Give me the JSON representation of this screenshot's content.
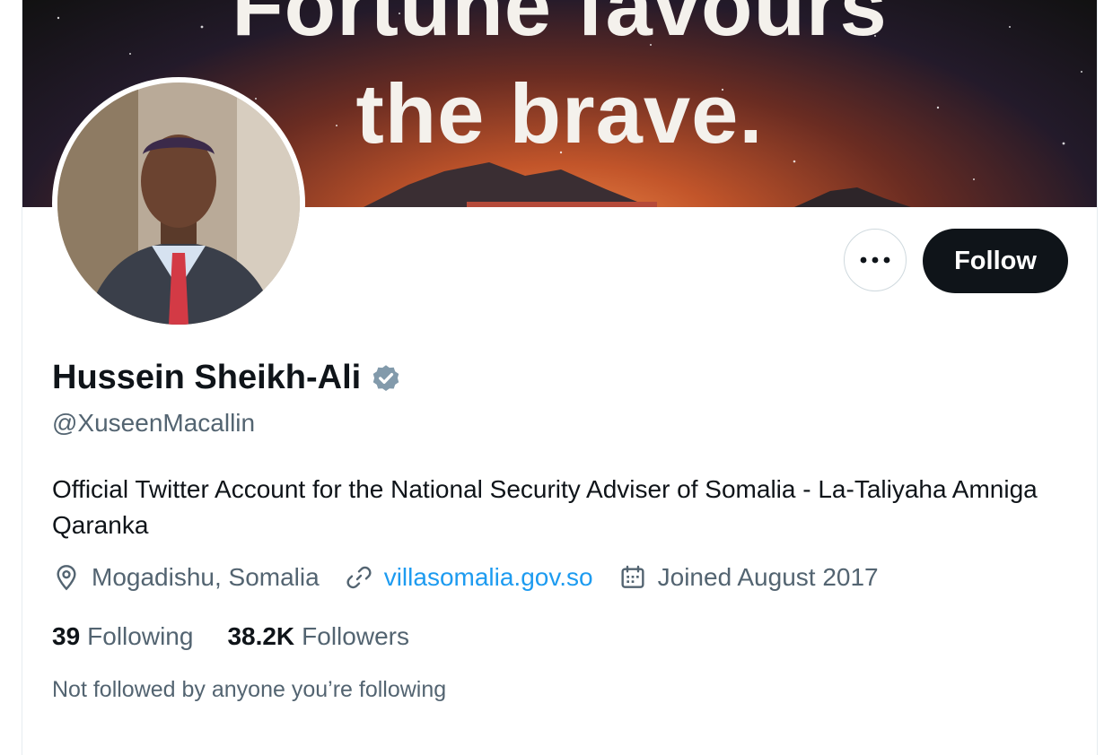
{
  "banner": {
    "line1": "Fortune favours",
    "line2": "the brave."
  },
  "profile": {
    "name": "Hussein Sheikh-Ali",
    "handle": "@XuseenMacallin",
    "bio": "Official Twitter Account for the National Security Adviser of Somalia - La-Taliyaha Amniga Qaranka",
    "location": "Mogadishu, Somalia",
    "website": "villasomalia.gov.so",
    "joined": "Joined August 2017"
  },
  "stats": {
    "following_count": "39",
    "following_label": "Following",
    "followers_count": "38.2K",
    "followers_label": "Followers"
  },
  "social_context": "Not followed by anyone you’re following",
  "actions": {
    "follow_label": "Follow"
  },
  "icons": {
    "more": "more-icon",
    "verified": "verified-badge-icon",
    "location": "location-pin-icon",
    "link": "link-icon",
    "calendar": "calendar-icon"
  },
  "colors": {
    "accent": "#1d9bf0",
    "text_primary": "#0f1419",
    "text_secondary": "#536471",
    "follow_bg": "#0f1419",
    "verified": "#829aab"
  }
}
